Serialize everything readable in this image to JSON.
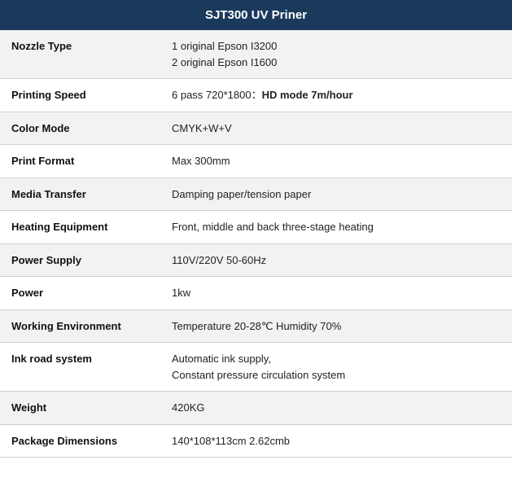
{
  "header": {
    "title": "SJT300 UV Priner"
  },
  "rows": [
    {
      "label": "Nozzle Type",
      "value": "1 original Epson I3200\n2 original Epson I1600",
      "has_bold": false
    },
    {
      "label": "Printing Speed",
      "value_prefix": "6 pass 720*1800：",
      "value_bold": "HD mode 7m/hour",
      "has_bold": true
    },
    {
      "label": "Color Mode",
      "value": "CMYK+W+V",
      "has_bold": false
    },
    {
      "label": "Print Format",
      "value": "Max 300mm",
      "has_bold": false
    },
    {
      "label": "Media Transfer",
      "value": "Damping paper/tension paper",
      "has_bold": false
    },
    {
      "label": "Heating Equipment",
      "value": "Front, middle and back three-stage heating",
      "has_bold": false
    },
    {
      "label": "Power Supply",
      "value": "110V/220V 50-60Hz",
      "has_bold": false
    },
    {
      "label": "Power",
      "value": "1kw",
      "has_bold": false
    },
    {
      "label": "Working Environment",
      "value": "Temperature 20-28℃  Humidity 70%",
      "has_bold": false
    },
    {
      "label": "Ink road system",
      "value": "Automatic ink supply,\nConstant pressure circulation system",
      "has_bold": false
    },
    {
      "label": "Weight",
      "value": "420KG",
      "has_bold": false
    },
    {
      "label": "Package Dimensions",
      "value": "140*108*113cm 2.62cmb",
      "has_bold": false
    }
  ]
}
